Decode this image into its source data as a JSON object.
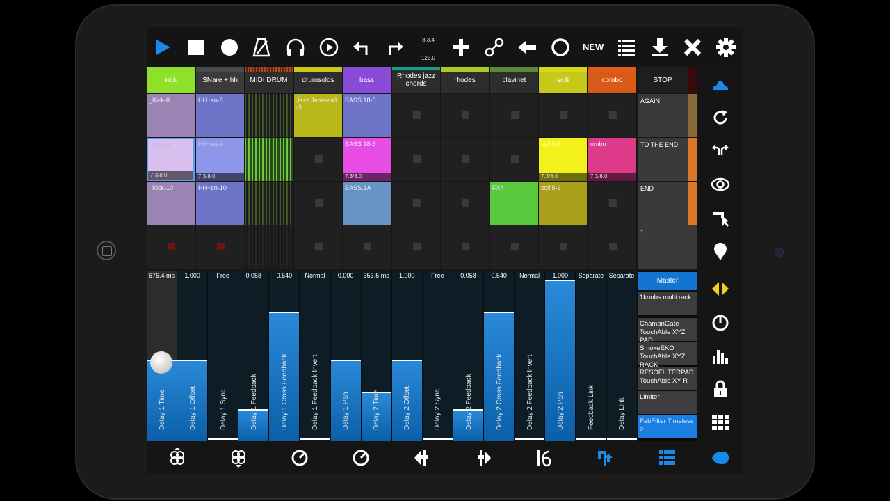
{
  "toolbar": {
    "tempo_top": "8.3.4",
    "tempo_bottom": "123.0",
    "new_label": "NEW"
  },
  "tracks": [
    {
      "name": "kick",
      "color": "#8ee02a",
      "head_bg": "#8ee02a"
    },
    {
      "name": "SNare + hh",
      "color": "#4a4a4a",
      "head_bg": "#3a3a3a"
    },
    {
      "name": "MIDI DRUM",
      "color": "#b5481e",
      "head_bg": "#2d2d2d"
    },
    {
      "name": "drumsolos",
      "color": "#c8c81a",
      "head_bg": "#2d2d2d"
    },
    {
      "name": "bass",
      "color": "#8a4cd8",
      "head_bg": "#8a4cd8"
    },
    {
      "name": "Rhodes jazz chords",
      "color": "#1a9e84",
      "head_bg": "#2d2d2d"
    },
    {
      "name": "rhodes",
      "color": "#a8cc22",
      "head_bg": "#2d2d2d"
    },
    {
      "name": "clavinet",
      "color": "#5c8a3c",
      "head_bg": "#2d2d2d"
    },
    {
      "name": "scifi",
      "color": "#d8d81a",
      "head_bg": "#c8c81a"
    },
    {
      "name": "combo",
      "color": "#e05a1a",
      "head_bg": "#d85a18"
    }
  ],
  "stop_label": "STOP",
  "clips": {
    "r0c0": "_Kick-8",
    "r0c1": "HH+sn-8",
    "r0c3": "Jazz Jamaica1 -3",
    "r0c4": "BASS 18-5",
    "r1c0": "_Kick-9",
    "r1c1": "HH+sn-9",
    "r1c4": "BASS 18-6",
    "r1c8": "scifi8-5",
    "r1c9": "ombo",
    "r2c0": "_Kick-10",
    "r2c1": "HH+sn-10",
    "r2c4": "BASS.1A",
    "r2c7": "FX4",
    "r2c8": "scifi8-6",
    "progress": "7.3/8.0"
  },
  "scenes": [
    "AGAIN",
    "TO THE END",
    "END",
    "1"
  ],
  "params": [
    {
      "label": "Delay 1 Time",
      "value": "676.4 ms"
    },
    {
      "label": "Delay 1 Offset",
      "value": "1.000"
    },
    {
      "label": "Delay 1 Sync",
      "value": "Free"
    },
    {
      "label": "Delay 1 Feedback",
      "value": "0.058"
    },
    {
      "label": "Delay 1 Cross Feedback",
      "value": "0.540"
    },
    {
      "label": "Delay 1 Feedback Invert",
      "value": "Normal"
    },
    {
      "label": "Delay 1 Pan",
      "value": "0.000"
    },
    {
      "label": "Delay 2 Time",
      "value": "353.5 ms"
    },
    {
      "label": "Delay 2 Offset",
      "value": "1.000"
    },
    {
      "label": "Delay 2 Sync",
      "value": "Free"
    },
    {
      "label": "Delay 2 Feedback",
      "value": "0.058"
    },
    {
      "label": "Delay 2 Cross Feedback",
      "value": "0.540"
    },
    {
      "label": "Delay 2 Feedback Invert",
      "value": "Normal"
    },
    {
      "label": "Delay 2 Pan",
      "value": "1.000"
    },
    {
      "label": "Feedback Link",
      "value": "Separate"
    },
    {
      "label": "Delay Link",
      "value": "Separate"
    }
  ],
  "param_levels": [
    0.5,
    0.5,
    0.0,
    0.19,
    0.8,
    0.0,
    0.5,
    0.3,
    0.5,
    0.0,
    0.19,
    0.8,
    0.0,
    1.0,
    0.0,
    0.0
  ],
  "devices": [
    "Master",
    "1knobs multi rack",
    "ChamanGate TouchAble XYZ PAD",
    "SmokeEKO TouchAble XYZ RACK",
    "RESOFILTERPAD TouchAble XY R",
    "Limiter",
    "FabFilter Timeless 2"
  ],
  "colors": {
    "accent": "#1a8ae8",
    "sidebar_yellow": "#f0d01a"
  },
  "icons": {
    "toolbar": [
      "play-icon",
      "stop-icon",
      "record-icon",
      "metronome-icon",
      "headphones-icon",
      "play-circle-icon",
      "undo-icon",
      "redo-icon",
      "plus-icon",
      "link-icon",
      "back-arrow-icon",
      "circle-icon",
      "list-icon",
      "download-icon",
      "close-icon",
      "gear-icon"
    ],
    "sidebar": [
      "clip-icon",
      "reload-icon",
      "swap-icon",
      "eye-icon",
      "cursor-icon",
      "location-icon",
      "arrows-icon",
      "power-icon",
      "bars-icon",
      "lock-icon",
      "grid-icon"
    ],
    "bottom": [
      "knot-icon",
      "knot-down-icon",
      "dial-icon",
      "dial-alt-icon",
      "fader-left-icon",
      "fader-right-icon",
      "sixteen-icon",
      "tap-icon",
      "list-stack-icon",
      "blob-icon"
    ]
  }
}
